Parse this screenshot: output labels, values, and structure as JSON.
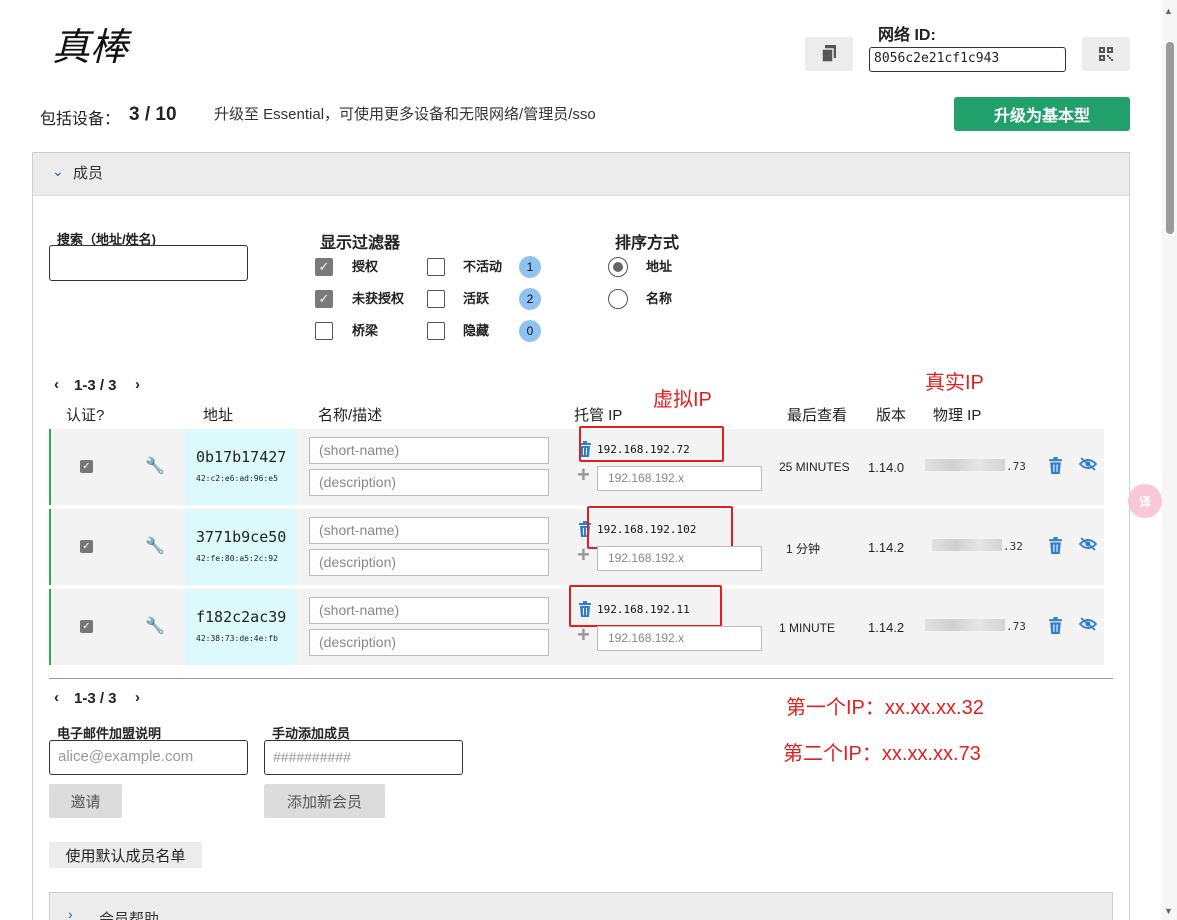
{
  "header": {
    "title": "真棒",
    "network_id_label": "网络 ID:",
    "network_id_value": "8056c2e21cf1c943"
  },
  "devices": {
    "label": "包括设备：",
    "count": "3 / 10",
    "upgrade_note": "升级至 Essential，可使用更多设备和无限网络/管理员/sso",
    "upgrade_button": "升级为基本型"
  },
  "members_panel": {
    "title": "成员",
    "search_label": "搜索（地址/姓名)",
    "filter_title": "显示过滤器",
    "filters": [
      {
        "label": "授权",
        "checked": true
      },
      {
        "label": "未获授权",
        "checked": true
      },
      {
        "label": "桥梁",
        "checked": false
      }
    ],
    "filters_right": [
      {
        "label": "不活动",
        "checked": false,
        "count": "1"
      },
      {
        "label": "活跃",
        "checked": false,
        "count": "2"
      },
      {
        "label": "隐藏",
        "checked": false,
        "count": "0"
      }
    ],
    "sort_title": "排序方式",
    "sort_options": [
      {
        "label": "地址",
        "selected": true
      },
      {
        "label": "名称",
        "selected": false
      }
    ],
    "pager_top": "1-3 / 3",
    "pager_bottom": "1-3 / 3",
    "columns": {
      "auth": "认证?",
      "address": "地址",
      "name": "名称/描述",
      "managed_ip": "托管 IP",
      "last_seen": "最后查看",
      "version": "版本",
      "physical_ip": "物理 IP"
    },
    "rows": [
      {
        "address": "0b17b17427",
        "mac": "42:c2:e6:ad:96:e5",
        "name_placeholder": "(short-name)",
        "desc_placeholder": "(description)",
        "ip": "192.168.192.72",
        "ip_placeholder": "192.168.192.x",
        "last_seen": "25 MINUTES",
        "version": "1.14.0",
        "physical_suffix": ".73"
      },
      {
        "address": "3771b9ce50",
        "mac": "42:fe:80:a5:2c:92",
        "name_placeholder": "(short-name)",
        "desc_placeholder": "(description)",
        "ip": "192.168.192.102",
        "ip_placeholder": "192.168.192.x",
        "last_seen": "1 分钟",
        "version": "1.14.2",
        "physical_suffix": ".32"
      },
      {
        "address": "f182c2ac39",
        "mac": "42:38:73:de:4e:fb",
        "name_placeholder": "(short-name)",
        "desc_placeholder": "(description)",
        "ip": "192.168.192.11",
        "ip_placeholder": "192.168.192.x",
        "last_seen": "1 MINUTE",
        "version": "1.14.2",
        "physical_suffix": ".73"
      }
    ],
    "email_label": "电子邮件加盟说明",
    "email_placeholder": "alice@example.com",
    "invite_button": "邀请",
    "manual_label": "手动添加成员",
    "manual_placeholder": "##########",
    "add_member_button": "添加新会员",
    "default_list_button": "使用默认成员名单",
    "help_title": "会员帮助"
  },
  "annotations": {
    "virtual_ip": "虚拟IP",
    "real_ip": "真实IP",
    "first_ip": "第一个IP：xx.xx.xx.32",
    "second_ip": "第二个IP：xx.xx.xx.73"
  },
  "colors": {
    "accent_green": "#22a06b",
    "row_border_green": "#2fa84f",
    "address_bg": "#dcfafb",
    "annotation_red": "#e02020",
    "icon_blue": "#2f7fd1"
  }
}
